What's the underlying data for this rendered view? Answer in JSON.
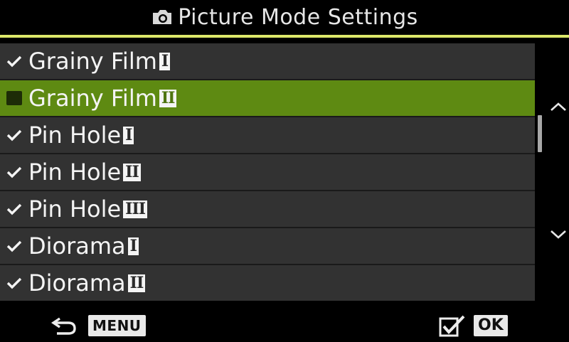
{
  "header": {
    "title": "Picture Mode Settings",
    "icon": "camera-icon"
  },
  "items": [
    {
      "label": "Grainy Film",
      "numeral": "I",
      "checked": true,
      "selected": false
    },
    {
      "label": "Grainy Film",
      "numeral": "II",
      "checked": false,
      "selected": true
    },
    {
      "label": "Pin Hole",
      "numeral": "I",
      "checked": true,
      "selected": false
    },
    {
      "label": "Pin Hole",
      "numeral": "II",
      "checked": true,
      "selected": false
    },
    {
      "label": "Pin Hole",
      "numeral": "III",
      "checked": true,
      "selected": false
    },
    {
      "label": "Diorama",
      "numeral": "I",
      "checked": true,
      "selected": false
    },
    {
      "label": "Diorama",
      "numeral": "II",
      "checked": true,
      "selected": false
    }
  ],
  "footer": {
    "back_icon": "back-arrow-icon",
    "menu_label": "MENU",
    "confirm_icon": "checkbox-check-icon",
    "ok_label": "OK"
  },
  "colors": {
    "accent_line": "#dde86a",
    "selected_row": "#5e8a12",
    "row_bg": "#323232"
  }
}
